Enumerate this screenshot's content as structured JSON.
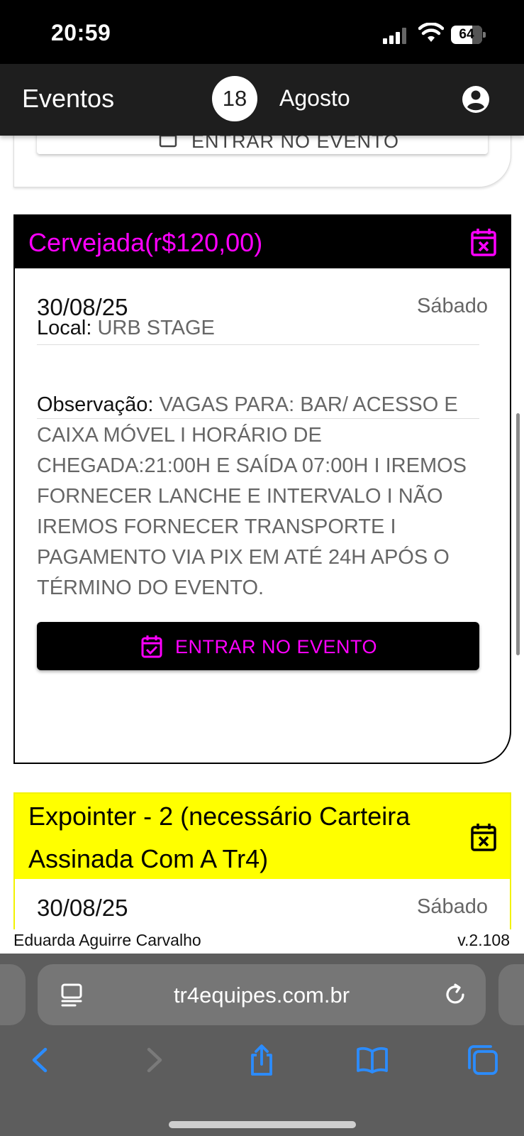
{
  "status_bar": {
    "time": "20:59",
    "battery": "64"
  },
  "app_bar": {
    "title": "Eventos",
    "day": "18",
    "month": "Agosto"
  },
  "previous_card": {
    "button_label": "ENTRAR NO EVENTO"
  },
  "events": [
    {
      "title": "Cervejada(r$120,00)",
      "date": "30/08/25",
      "weekday": "Sábado",
      "local_label": "Local:",
      "local_value": "URB STAGE",
      "obs_label": "Observação:",
      "obs_value": "VAGAS PARA: BAR/ ACESSO E CAIXA MÓVEL I HORÁRIO DE CHEGADA:21:00H E SAÍDA 07:00H I IREMOS FORNECER LANCHE E INTERVALO I NÃO IREMOS FORNECER TRANSPORTE I PAGAMENTO VIA PIX EM ATÉ 24H APÓS O TÉRMINO DO EVENTO.",
      "button_label": "ENTRAR NO EVENTO",
      "header_bg": "#000000",
      "header_fg": "#ff00ff"
    },
    {
      "title": "Expointer - 2 (necessário Carteira Assinada Com A Tr4)",
      "date": "30/08/25",
      "weekday": "Sábado",
      "header_bg": "#ffff00",
      "header_fg": "#000000"
    }
  ],
  "footer": {
    "user": "Eduarda Aguirre Carvalho",
    "version": "v.2.108"
  },
  "browser": {
    "url": "tr4equipes.com.br"
  },
  "icons": {
    "account": "account-circle-icon",
    "event_cancel": "calendar-x-icon",
    "join": "calendar-check-icon",
    "reader": "reader-mode-icon",
    "reload": "reload-icon",
    "back": "back-arrow-icon",
    "forward": "forward-arrow-icon",
    "share": "share-icon",
    "bookmarks": "bookmarks-icon",
    "tabs": "tabs-icon"
  }
}
